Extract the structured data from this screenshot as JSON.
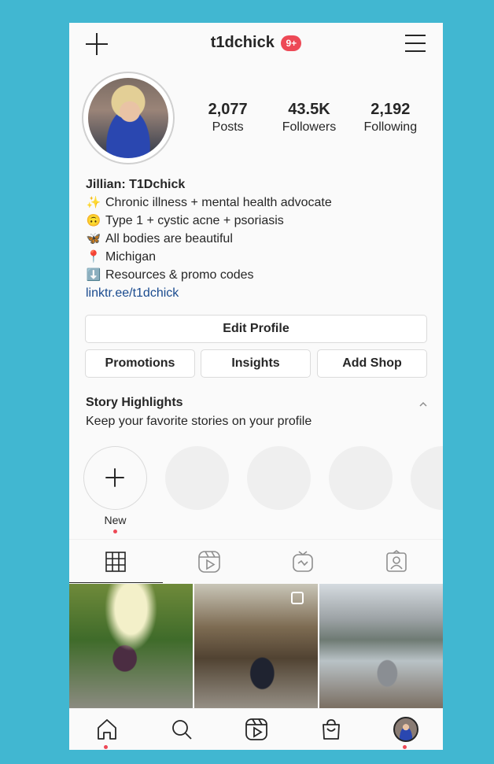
{
  "header": {
    "username": "t1dchick",
    "notification_badge": "9+",
    "icons": [
      "plus-icon",
      "menu-icon"
    ]
  },
  "profile": {
    "stats": [
      {
        "value": "2,077",
        "label": "Posts"
      },
      {
        "value": "43.5K",
        "label": "Followers"
      },
      {
        "value": "2,192",
        "label": "Following"
      }
    ],
    "bio": {
      "name": "Jillian: T1Dchick",
      "lines": [
        {
          "emoji": "✨",
          "text": "Chronic illness + mental health advocate"
        },
        {
          "emoji": "🙃",
          "text": "Type 1 + cystic acne + psoriasis"
        },
        {
          "emoji": "🦋",
          "text": "All bodies are beautiful"
        },
        {
          "emoji": "📍",
          "text": "Michigan"
        },
        {
          "emoji": "⬇️",
          "text": "Resources & promo codes"
        }
      ],
      "link": "linktr.ee/t1dchick"
    }
  },
  "buttons": {
    "edit_profile": "Edit Profile",
    "promotions": "Promotions",
    "insights": "Insights",
    "add_shop": "Add Shop"
  },
  "highlights": {
    "title": "Story Highlights",
    "subtitle": "Keep your favorite stories on your profile",
    "new_label": "New"
  },
  "tabs": [
    "grid-icon",
    "reels-icon",
    "igtv-icon",
    "tagged-icon"
  ],
  "bottom_nav": [
    "home-icon",
    "search-icon",
    "reels-icon",
    "shop-icon",
    "profile-avatar"
  ],
  "colors": {
    "background": "#41b7d1",
    "badge": "#ed4956",
    "link": "#1a4b8f"
  }
}
